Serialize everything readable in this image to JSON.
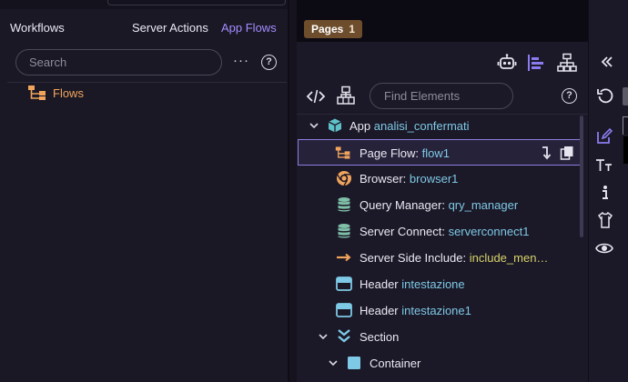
{
  "workflows": {
    "title": "Workflows",
    "tab_server_actions": "Server Actions",
    "tab_app_flows": "App Flows",
    "search_placeholder": "Search",
    "more_label": "···",
    "help_label": "?",
    "tree": [
      {
        "label": "Flows",
        "icon": "flow-icon"
      }
    ]
  },
  "pages": {
    "tab_label": "Pages",
    "tab_count": "1",
    "find_placeholder": "Find Elements",
    "toolbar_icons": [
      "robot-icon",
      "align-left-icon",
      "sitemap-icon"
    ],
    "row2_icons": [
      "code-icon",
      "component-tree-icon"
    ],
    "tree": [
      {
        "key": "App",
        "value": "analisi_confermati",
        "icon": "cube-icon",
        "expanded": true
      },
      {
        "key": "Page Flow:",
        "value": "flow1",
        "icon": "flow-icon",
        "selected": true
      },
      {
        "key": "Browser:",
        "value": "browser1",
        "icon": "chrome-icon"
      },
      {
        "key": "Query Manager:",
        "value": "qry_manager",
        "icon": "database-icon"
      },
      {
        "key": "Server Connect:",
        "value": "serverconnect1",
        "icon": "database-icon"
      },
      {
        "key": "Server Side Include:",
        "value": "include_men…",
        "icon": "arrow-right-icon"
      },
      {
        "key": "Header",
        "value": "intestazione",
        "icon": "header-icon"
      },
      {
        "key": "Header",
        "value": "intestazione1",
        "icon": "header-icon"
      },
      {
        "key": "Section",
        "value": "",
        "icon": "section-icon",
        "expanded": true
      },
      {
        "key": "Container",
        "value": "",
        "icon": "container-icon",
        "expanded": true
      }
    ]
  },
  "properties": {
    "collapse_icon": "double-chevron-left-icon",
    "refresh_icon": "refresh-icon",
    "tabs": [
      "edit-icon",
      "typography-icon",
      "info-icon",
      "shirt-icon",
      "eye-icon"
    ]
  },
  "colors": {
    "accent": "#a58cff",
    "flows_orange": "#f0a45c",
    "value_blue": "#7ec9e6",
    "value_yellow": "#d6d36a",
    "tab_brown": "#6d4d2b",
    "icon_teal": "#5fc0c8"
  }
}
